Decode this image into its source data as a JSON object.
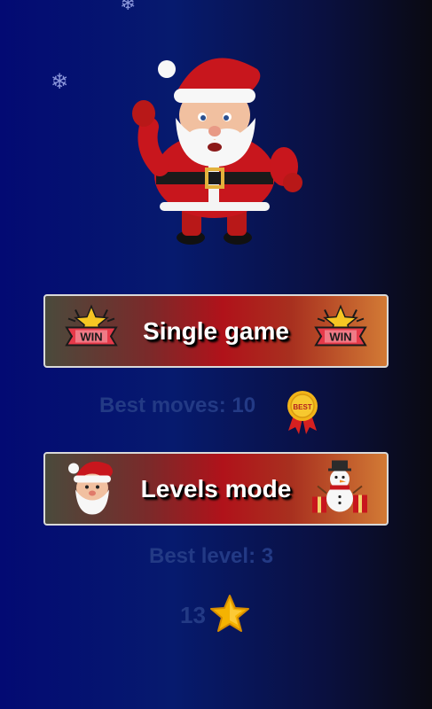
{
  "colors": {
    "background_start": "#030a73",
    "background_end": "#0a0a12",
    "button_border": "#d9d9d9",
    "stat_text": "#233a85",
    "star": "#f5b301"
  },
  "hero": {
    "image": "santa-claus-waving"
  },
  "single_game": {
    "label": "Single game",
    "left_icon": "win-badge-icon",
    "right_icon": "win-badge-icon",
    "badge_text": "WIN"
  },
  "best_moves": {
    "label": "Best moves: 10",
    "icon": "best-medal-icon",
    "medal_text": "BEST"
  },
  "levels_mode": {
    "label": "Levels mode",
    "left_icon": "santa-face-icon",
    "right_icon": "snowman-gifts-icon"
  },
  "best_level": {
    "label": "Best level: 3"
  },
  "stars": {
    "count": "13",
    "icon": "star-icon"
  }
}
